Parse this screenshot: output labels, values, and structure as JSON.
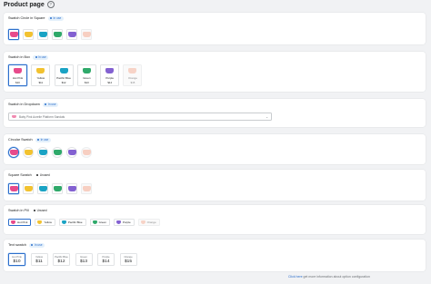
{
  "page": {
    "title": "Product page"
  },
  "colors": {
    "hot_pink": "#e74a8b",
    "yellow": "#f2c230",
    "pacific_blue": "#1aa3c4",
    "green": "#2fa96a",
    "purple": "#8361d1",
    "orange": "#f2b09a",
    "accent": "#2c6ecb"
  },
  "sections": {
    "circle_in_square": {
      "title": "Swatch Circle in Square",
      "badge": "In use"
    },
    "swatch_in_box": {
      "title": "Swatch in Box",
      "badge": "In use",
      "items": [
        {
          "name": "Hot Pink",
          "price": "$10"
        },
        {
          "name": "Yellow",
          "price": "$11"
        },
        {
          "name": "Pacific Blue",
          "price": "$12"
        },
        {
          "name": "Green",
          "price": "$13"
        },
        {
          "name": "Purple",
          "price": "$14"
        },
        {
          "name": "Orange",
          "price": "$15"
        }
      ]
    },
    "swatch_in_dropdown": {
      "title": "Swatch in Dropdown",
      "badge": "In use",
      "selected": "Baby Pink Aurelie Platform Sandals"
    },
    "circular_swatch": {
      "title": "Circular Swatch",
      "badge": "In use"
    },
    "square_swatch": {
      "title": "Square Swatch",
      "badge": "Unused"
    },
    "swatch_in_pill": {
      "title": "Swatch in Pill",
      "badge": "Unused",
      "items": [
        "Hot Pink",
        "Yellow",
        "Pacific Blue",
        "Green",
        "Purple",
        "Orange"
      ]
    },
    "text_swatch": {
      "title": "Text swatch",
      "badge": "In use",
      "items": [
        {
          "name": "Hot Pink",
          "price": "$10"
        },
        {
          "name": "Yellow",
          "price": "$11"
        },
        {
          "name": "Pacific Blue",
          "price": "$12"
        },
        {
          "name": "Green",
          "price": "$13"
        },
        {
          "name": "Purple",
          "price": "$14"
        },
        {
          "name": "Orange",
          "price": "$15"
        }
      ]
    }
  },
  "footer": {
    "link": "Click here",
    "text": " get more information about option configuration"
  }
}
